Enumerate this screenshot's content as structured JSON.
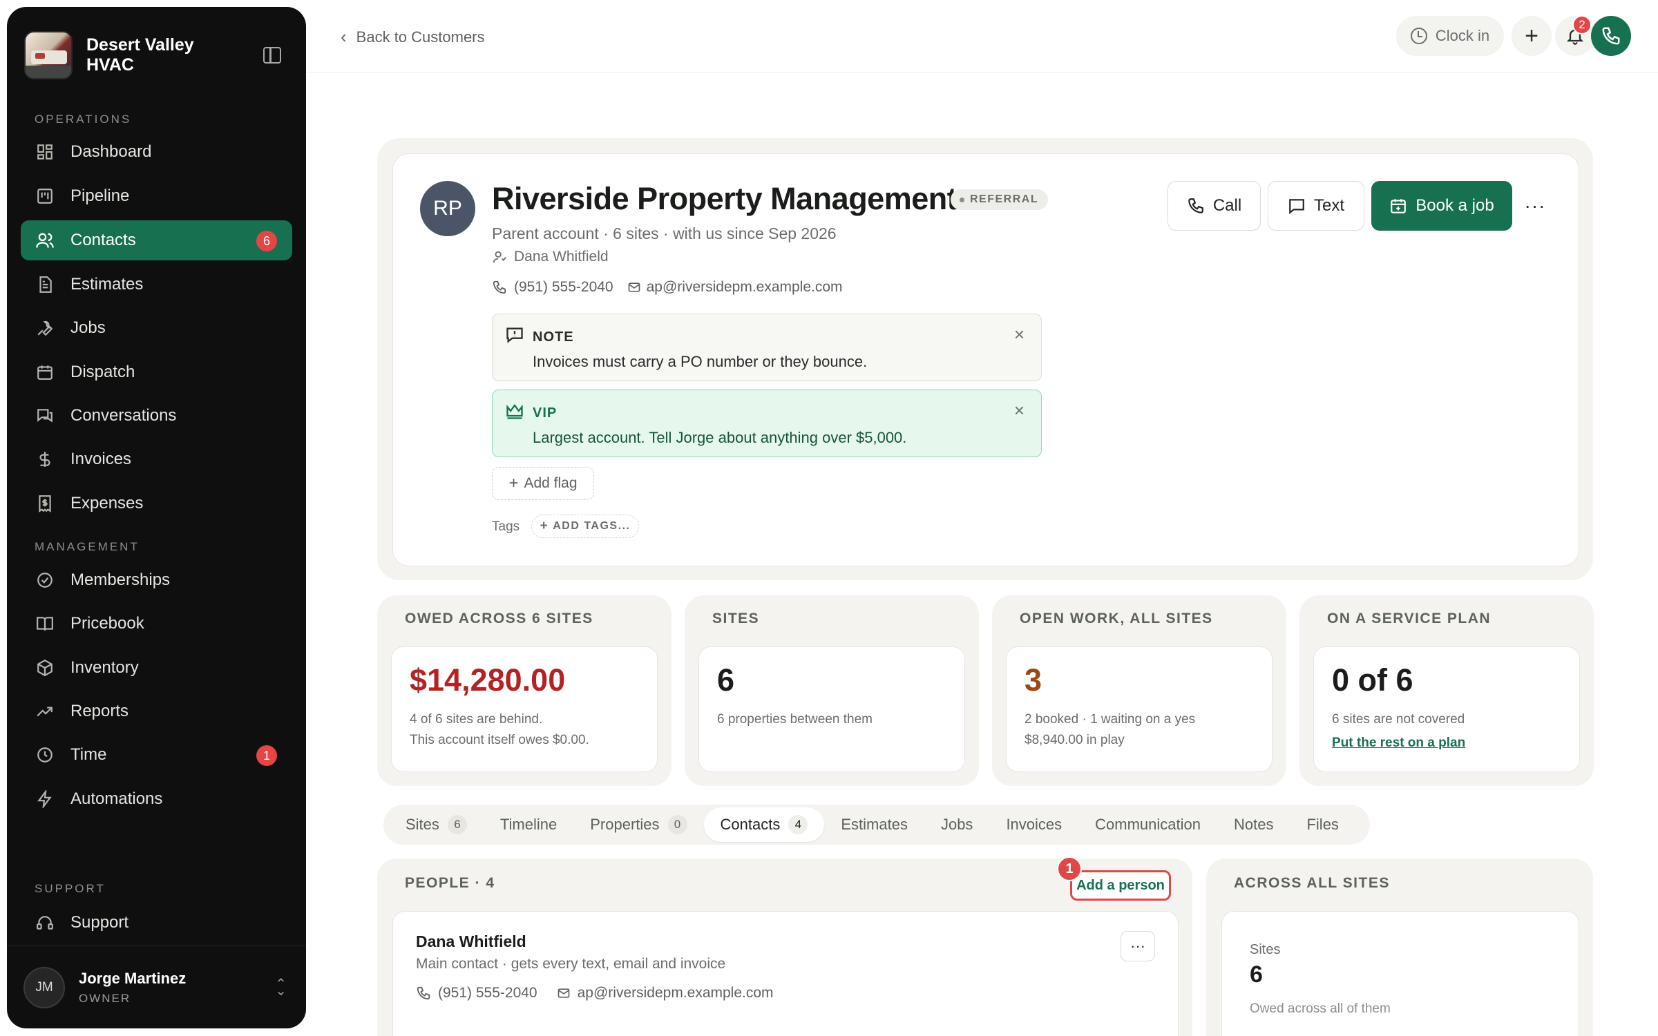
{
  "brand": {
    "name": "Desert Valley HVAC"
  },
  "sidebar": {
    "sections": {
      "operations": "OPERATIONS",
      "management": "MANAGEMENT",
      "support": "SUPPORT"
    },
    "items": [
      {
        "label": "Dashboard",
        "icon": "dashboard-icon"
      },
      {
        "label": "Pipeline",
        "icon": "pipeline-icon"
      },
      {
        "label": "Contacts",
        "icon": "contacts-icon",
        "badge": "6",
        "active": true
      },
      {
        "label": "Estimates",
        "icon": "estimates-icon"
      },
      {
        "label": "Jobs",
        "icon": "wrench-icon"
      },
      {
        "label": "Dispatch",
        "icon": "calendar-icon"
      },
      {
        "label": "Conversations",
        "icon": "chat-icon"
      },
      {
        "label": "Invoices",
        "icon": "dollar-icon"
      },
      {
        "label": "Expenses",
        "icon": "receipt-icon"
      },
      {
        "label": "Memberships",
        "icon": "badge-check-icon"
      },
      {
        "label": "Pricebook",
        "icon": "book-icon"
      },
      {
        "label": "Inventory",
        "icon": "box-icon"
      },
      {
        "label": "Reports",
        "icon": "trend-icon"
      },
      {
        "label": "Time",
        "icon": "clock-icon",
        "badge": "1"
      },
      {
        "label": "Automations",
        "icon": "bolt-icon"
      },
      {
        "label": "Support",
        "icon": "headset-icon"
      }
    ],
    "user": {
      "initials": "JM",
      "name": "Jorge Martinez",
      "role": "OWNER"
    }
  },
  "topbar": {
    "back_label": "Back to Customers",
    "clock_in_label": "Clock in",
    "notification_count": "2"
  },
  "customer": {
    "initials": "RP",
    "name": "Riverside Property Management",
    "source_tag": "REFERRAL",
    "subtitle": "Parent account · 6 sites · with us since Sep 2026",
    "contact_person": "Dana Whitfield",
    "phone": "(951) 555-2040",
    "email": "ap@riversidepm.example.com",
    "actions": {
      "call": "Call",
      "text": "Text",
      "book": "Book a job",
      "more": "···"
    },
    "flags": [
      {
        "title": "NOTE",
        "text": "Invoices must carry a PO number or they bounce."
      },
      {
        "title": "VIP",
        "text": "Largest account. Tell Jorge about anything over $5,000."
      }
    ],
    "add_flag_label": "Add flag",
    "tags_label": "Tags",
    "add_tags_label": "ADD TAGS..."
  },
  "stats": [
    {
      "label": "OWED ACROSS 6 SITES",
      "value": "$14,280.00",
      "desc1": "4 of 6 sites are behind.",
      "desc2": "This account itself owes $0.00."
    },
    {
      "label": "SITES",
      "value": "6",
      "desc1": "6 properties between them"
    },
    {
      "label": "OPEN WORK, ALL SITES",
      "value": "3",
      "desc1": "2 booked · 1 waiting on a yes",
      "desc2": "$8,940.00 in play"
    },
    {
      "label": "ON A SERVICE PLAN",
      "value": "0 of 6",
      "desc1": "6 sites are not covered",
      "link": "Put the rest on a plan"
    }
  ],
  "tabs": [
    {
      "label": "Sites",
      "count": "6"
    },
    {
      "label": "Timeline"
    },
    {
      "label": "Properties",
      "count": "0"
    },
    {
      "label": "Contacts",
      "count": "4",
      "active": true
    },
    {
      "label": "Estimates"
    },
    {
      "label": "Jobs"
    },
    {
      "label": "Invoices"
    },
    {
      "label": "Communication"
    },
    {
      "label": "Notes"
    },
    {
      "label": "Files"
    }
  ],
  "people": {
    "label": "PEOPLE · 4",
    "add_label": "Add a person",
    "tour_step": "1",
    "items": [
      {
        "name": "Dana Whitfield",
        "role": "Main contact · gets every text, email and invoice",
        "phone": "(951) 555-2040",
        "email": "ap@riversidepm.example.com"
      }
    ]
  },
  "across": {
    "label": "ACROSS ALL SITES",
    "sites_label": "Sites",
    "sites_value": "6",
    "owed_label": "Owed across all of them"
  }
}
